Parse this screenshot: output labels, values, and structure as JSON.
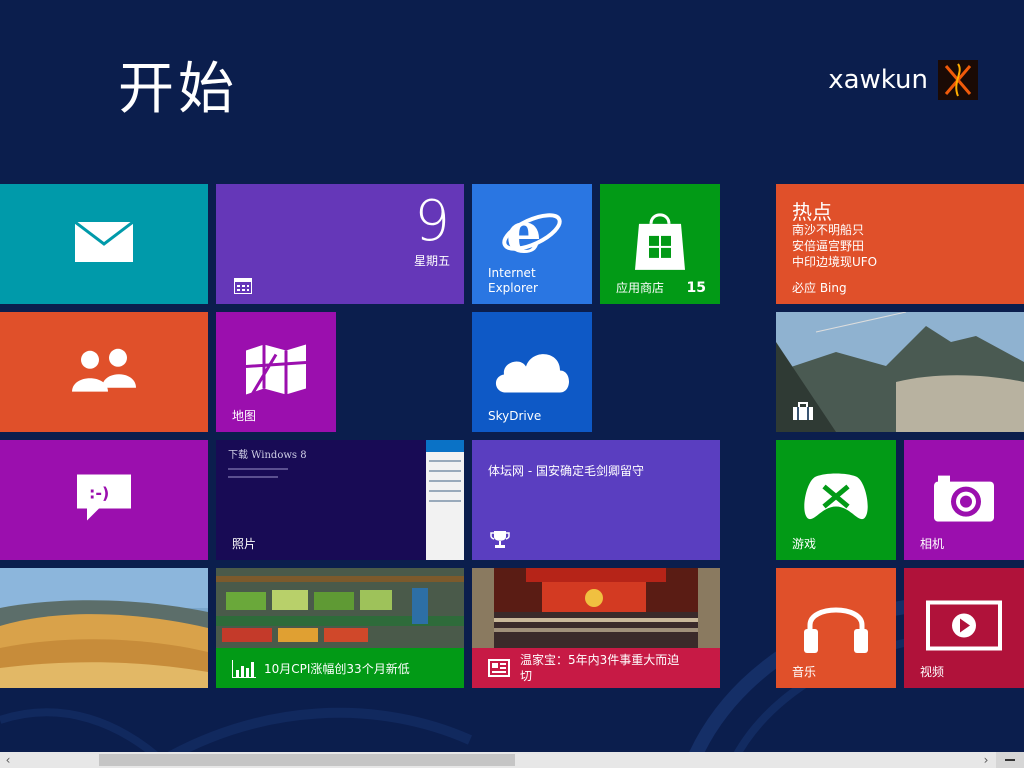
{
  "header": {
    "title": "开始",
    "username": "xawkun"
  },
  "tiles": {
    "mail": {
      "color": "#009aaa"
    },
    "calendar": {
      "day": "9",
      "weekday": "星期五",
      "color": "#6537b8"
    },
    "ie": {
      "label": "Internet Explorer",
      "color": "#2a76e2"
    },
    "store": {
      "label": "应用商店",
      "badge": "15",
      "color": "#029a16"
    },
    "bing": {
      "heading": "热点",
      "lines": [
        "南沙不明船只",
        "安倍逼宫野田",
        "中印边境现UFO"
      ],
      "label": "必应 Bing",
      "color": "#e0502a"
    },
    "people": {
      "color": "#e0502a"
    },
    "maps": {
      "label": "地图",
      "color": "#9b0fae"
    },
    "skydrive": {
      "label": "SkyDrive",
      "color": "#0e59c6"
    },
    "travel": {
      "color": "#3a5572"
    },
    "messaging": {
      "color": "#9b0fae"
    },
    "photos": {
      "label": "照片",
      "doc_title": "下载 Windows 8",
      "color": "#180b55"
    },
    "sports": {
      "headline": "体坛网 - 国安确定毛剑卿留守",
      "color": "#5a3ec0"
    },
    "games": {
      "label": "游戏",
      "color": "#029a16"
    },
    "camera": {
      "label": "相机",
      "color": "#9b0fae"
    },
    "desktop": {
      "color": "#8a6a3a"
    },
    "finance": {
      "headline": "10月CPI涨幅创33个月新低",
      "color": "#029a16"
    },
    "news": {
      "headline": "温家宝：5年内3件事重大而迫切",
      "color": "#c71a45"
    },
    "music": {
      "label": "音乐",
      "color": "#e0502a"
    },
    "video": {
      "label": "视频",
      "color": "#b0123a"
    }
  }
}
